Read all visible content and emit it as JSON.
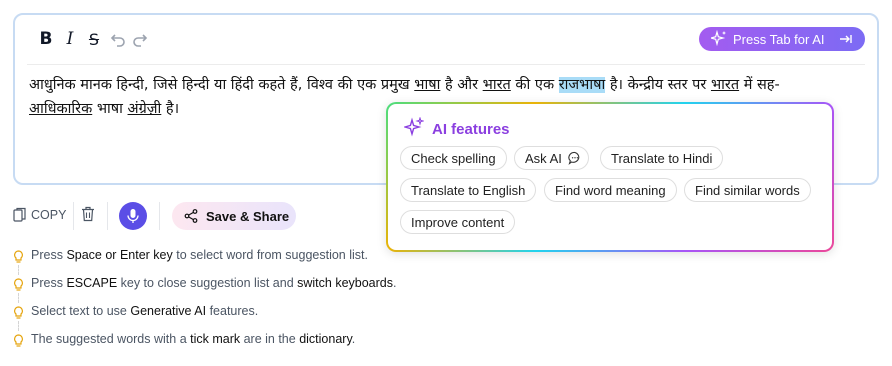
{
  "toolbar": {
    "bold_label": "B",
    "italic_label": "I",
    "strike_label": "S",
    "tab_ai_label": "Press Tab for AI"
  },
  "editor": {
    "line1_a": "आधुनिक मानक हिन्दी, जिसे हिन्दी या हिंदी कहते हैं, विश्व की एक प्रमुख ",
    "w_bhasha": "भाषा",
    "line1_b": " है और ",
    "w_bharat": "भारत",
    "line1_c": " की एक ",
    "w_rajbhasha": "राजभाषा",
    "line1_d": " है। केन्द्रीय स्तर पर ",
    "w_bharat2": "भारत",
    "line1_e": " में सह-",
    "w_adhikarik": "आधिकारिक",
    "line2_a": " भाषा ",
    "w_angrezi": "अंग्रेज़ी",
    "line2_b": " है।"
  },
  "ai_panel": {
    "title": "AI features",
    "chips": [
      "Check spelling",
      "Ask AI",
      "Translate to Hindi",
      "Translate to English",
      "Find word meaning",
      "Find similar words",
      "Improve content"
    ]
  },
  "actions": {
    "copy_label": "COPY",
    "share_label": "Save & Share"
  },
  "tips": [
    {
      "a": "Press ",
      "b": "Space or Enter key",
      "c": " to select word from suggestion list.",
      "d": "",
      "e": ""
    },
    {
      "a": "Press ",
      "b": "ESCAPE",
      "c": " key to close suggestion list and ",
      "d": "switch keyboards",
      "e": "."
    },
    {
      "a": "Select text to use ",
      "b": "Generative AI",
      "c": " features.",
      "d": "",
      "e": ""
    },
    {
      "a": "The suggested words with a ",
      "b": "tick mark",
      "c": " are in the ",
      "d": "dictionary",
      "e": "."
    }
  ],
  "colors": {
    "accent_purple": "#8b3fe0",
    "mic_blue": "#5b4ee6",
    "highlight": "#a9dcf7",
    "bulb": "#e5a40d"
  }
}
